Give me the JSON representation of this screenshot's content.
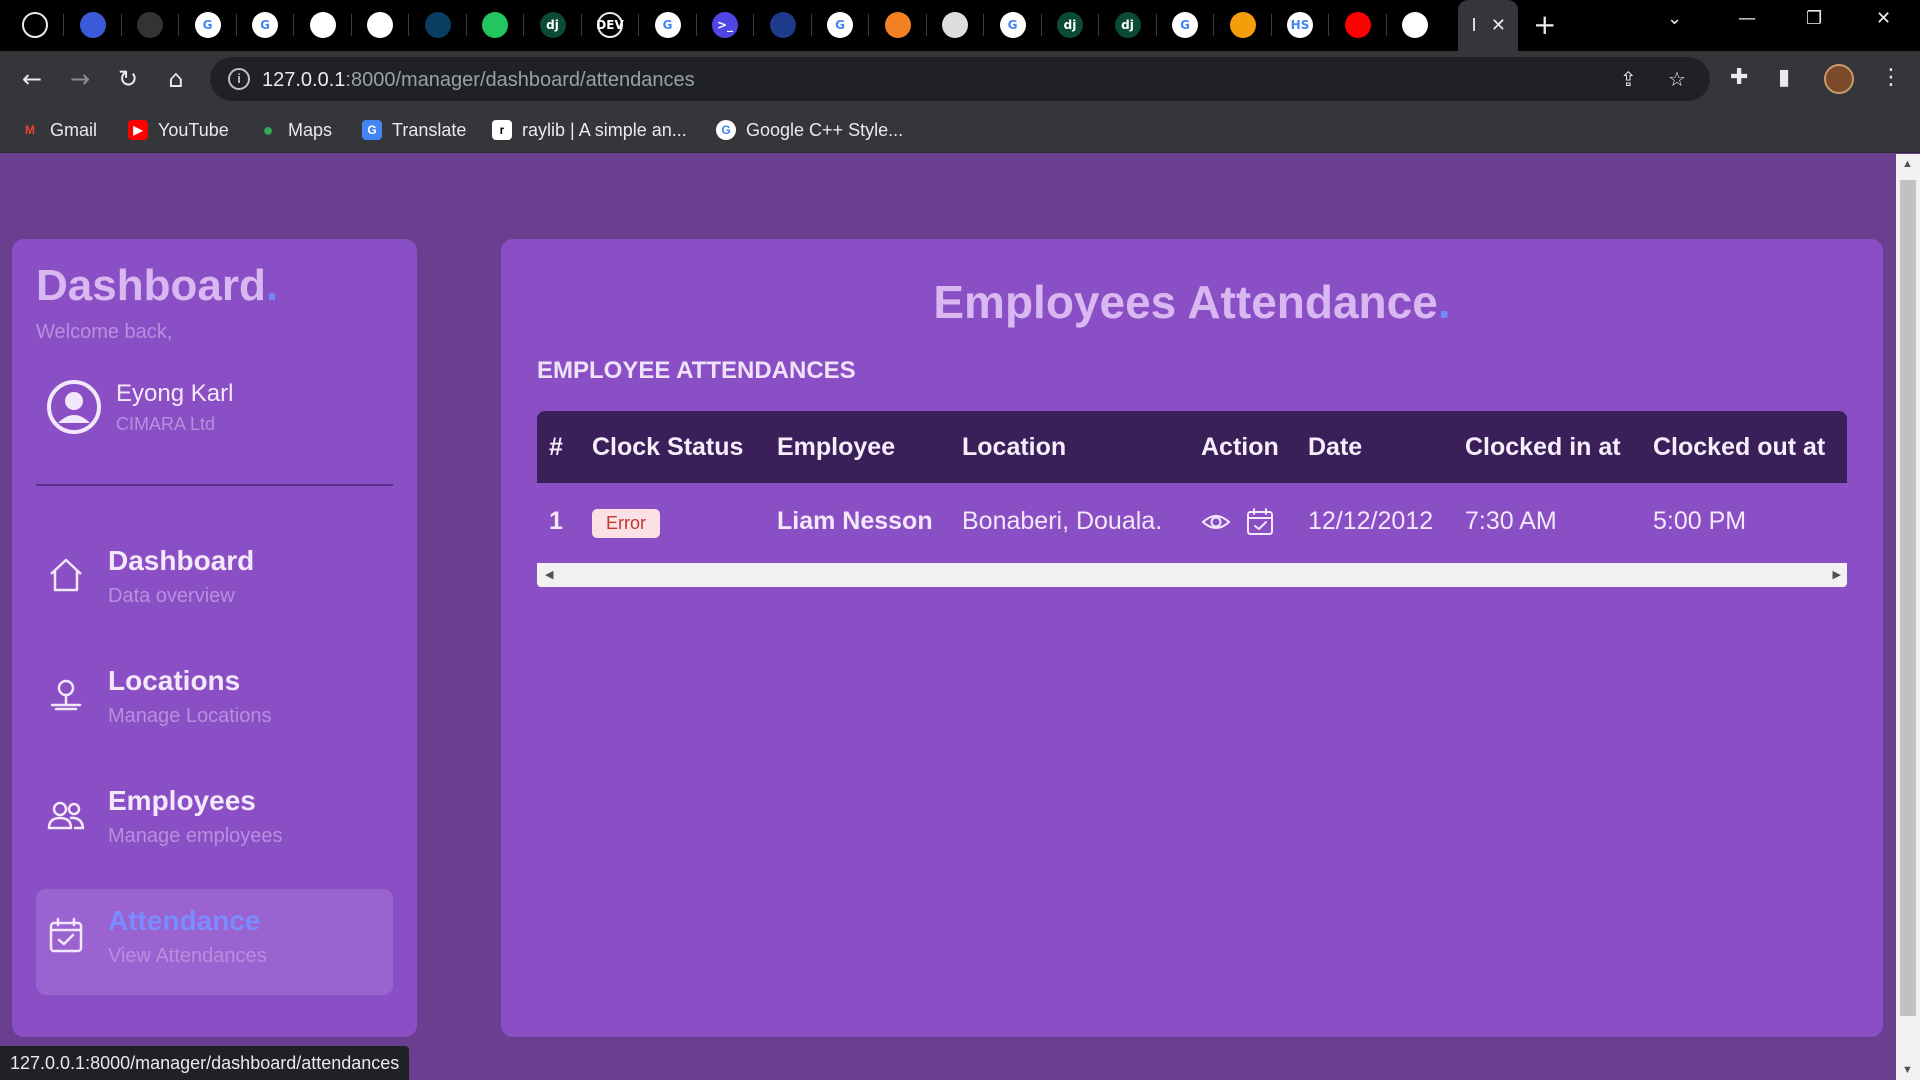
{
  "browser": {
    "tabs": [
      {
        "icon": "github-icon",
        "glyph": "",
        "color": "#000000"
      },
      {
        "icon": "analytics-icon",
        "glyph": "",
        "color": "#3b5bdb"
      },
      {
        "icon": "app-icon",
        "glyph": "",
        "color": "#333333"
      },
      {
        "icon": "google-icon",
        "glyph": "G",
        "color": "#ffffff"
      },
      {
        "icon": "google-icon",
        "glyph": "G",
        "color": "#ffffff"
      },
      {
        "icon": "openai-icon",
        "glyph": "",
        "color": "#ffffff"
      },
      {
        "icon": "openai-icon",
        "glyph": "",
        "color": "#ffffff"
      },
      {
        "icon": "code-icon",
        "glyph": "",
        "color": "#0a3d62"
      },
      {
        "icon": "play-icon",
        "glyph": "",
        "color": "#22c55e"
      },
      {
        "icon": "django-icon",
        "glyph": "dj",
        "color": "#0c4b33"
      },
      {
        "icon": "dev-icon",
        "glyph": "DEV",
        "color": "#000000"
      },
      {
        "icon": "google-icon",
        "glyph": "G",
        "color": "#ffffff"
      },
      {
        "icon": "terminal-icon",
        "glyph": ">_",
        "color": "#4f46e5"
      },
      {
        "icon": "brand-icon",
        "glyph": "",
        "color": "#1e3a8a"
      },
      {
        "icon": "google-icon",
        "glyph": "G",
        "color": "#ffffff"
      },
      {
        "icon": "stackoverflow-icon",
        "glyph": "",
        "color": "#f48024"
      },
      {
        "icon": "globe-icon",
        "glyph": "",
        "color": "#dddddd"
      },
      {
        "icon": "google-icon",
        "glyph": "G",
        "color": "#ffffff"
      },
      {
        "icon": "django-icon",
        "glyph": "dj",
        "color": "#0c4b33"
      },
      {
        "icon": "django-icon",
        "glyph": "dj",
        "color": "#0c4b33"
      },
      {
        "icon": "google-icon",
        "glyph": "G",
        "color": "#ffffff"
      },
      {
        "icon": "bolt-icon",
        "glyph": "",
        "color": "#f59e0b"
      },
      {
        "icon": "hs-icon",
        "glyph": "HS",
        "color": "#ffffff"
      },
      {
        "icon": "youtube-icon",
        "glyph": "",
        "color": "#ff0000"
      },
      {
        "icon": "chrome-icon",
        "glyph": "",
        "color": "#ffffff"
      }
    ],
    "active_tab_title": "I",
    "url_host": "127.0.0.1",
    "url_rest": ":8000/manager/dashboard/attendances",
    "bookmarks": [
      {
        "label": "Gmail",
        "icon": "gmail-icon",
        "glyph": "M",
        "color": "#ea4335"
      },
      {
        "label": "YouTube",
        "icon": "youtube-icon",
        "glyph": "",
        "color": "#ff0000"
      },
      {
        "label": "Maps",
        "icon": "maps-icon",
        "glyph": "",
        "color": "#34a853"
      },
      {
        "label": "Translate",
        "icon": "translate-icon",
        "glyph": "G",
        "color": "#4285f4"
      },
      {
        "label": "raylib | A simple an...",
        "icon": "raylib-icon",
        "glyph": "",
        "color": "#ffffff"
      },
      {
        "label": "Google C++ Style...",
        "icon": "google-icon",
        "glyph": "G",
        "color": "#ffffff"
      }
    ],
    "status_url": "127.0.0.1:8000/manager/dashboard/attendances"
  },
  "sidebar": {
    "title": "Dashboard",
    "title_dot": ".",
    "welcome": "Welcome back,",
    "user_name": "Eyong Karl",
    "user_company": "CIMARA Ltd",
    "items": [
      {
        "title": "Dashboard",
        "subtitle": "Data overview"
      },
      {
        "title": "Locations",
        "subtitle": "Manage Locations"
      },
      {
        "title": "Employees",
        "subtitle": "Manage employees"
      },
      {
        "title": "Attendance",
        "subtitle": "View Attendances"
      }
    ]
  },
  "main": {
    "title": "Employees Attendance",
    "title_dot": ".",
    "section_title": "EMPLOYEE ATTENDANCES",
    "columns": [
      "#",
      "Clock Status",
      "Employee",
      "Location",
      "Action",
      "Date",
      "Clocked in at",
      "Clocked out at"
    ],
    "rows": [
      {
        "index": "1",
        "status": "Error",
        "employee": "Liam Nesson",
        "location": "Bonaberi, Douala.",
        "date": "12/12/2012",
        "clock_in": "7:30 AM",
        "clock_out": "5:00 PM"
      }
    ]
  },
  "colors": {
    "page_bg": "#6a3f8f",
    "card_bg": "#8a4fc4",
    "accent_dot": "#6f8cff",
    "table_header": "#3b1f58",
    "error_badge_bg": "#fbe0e6",
    "error_badge_text": "#c0392b"
  }
}
